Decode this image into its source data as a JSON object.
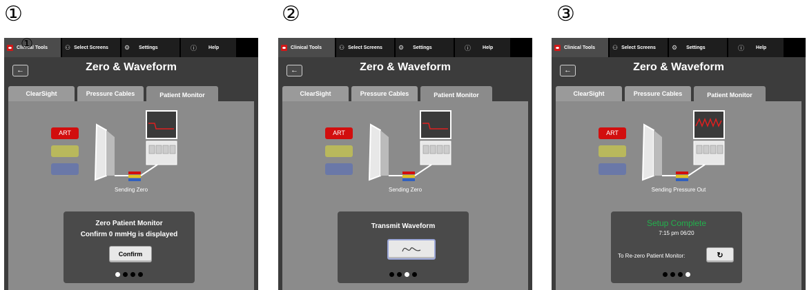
{
  "steps": [
    "①",
    "②",
    "③"
  ],
  "overlay_marker": "①",
  "topbar": {
    "clinical_tools": "Clinical Tools",
    "select_screens": "Select Screens",
    "settings": "Settings",
    "help": "Help"
  },
  "header": {
    "title": "Zero & Waveform",
    "back_icon": "←"
  },
  "tabs": [
    "ClearSight",
    "Pressure Cables",
    "Patient Monitor"
  ],
  "channels": {
    "art_label": "ART",
    "art_color": "#d20e0e",
    "yellow": "#b9b85c",
    "blue": "#6a78a8"
  },
  "screen1": {
    "caption": "Sending Zero",
    "dialog_line1": "Zero Patient Monitor",
    "dialog_line2": "Confirm 0 mmHg is displayed",
    "button": "Confirm",
    "progress_step": 1
  },
  "screen2": {
    "caption": "Sending Zero",
    "dialog_title": "Transmit Waveform",
    "button_icon": "waveform-icon",
    "progress_step": 3
  },
  "screen3": {
    "caption": "Sending Pressure Out",
    "status": "Setup Complete",
    "status_color": "#22b14c",
    "timestamp": "7:15 pm 06/20",
    "rezero_label": "To Re-zero Patient Monitor:",
    "rezero_icon": "refresh-icon",
    "progress_step": 4
  }
}
